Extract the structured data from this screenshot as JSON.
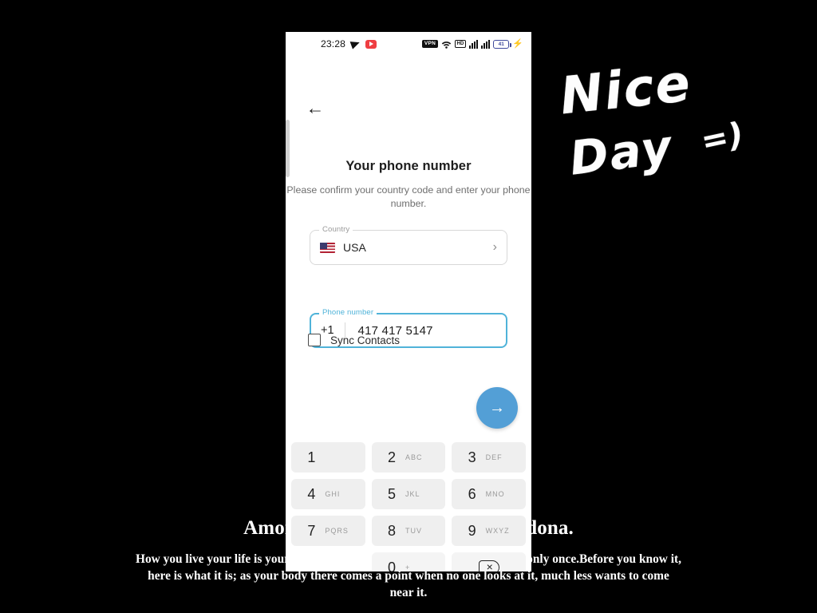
{
  "background": {
    "quote_title": "Amor ch'a nullo amato amar perdona.",
    "quote_body": "How you live your life is your own business, and our bodies are given to us only once.Before you know it,  here is what it is; as your body there comes a point when no one looks at it,  much less wants to come near it.",
    "handwritten_line1": "Nice",
    "handwritten_line2": "Day",
    "handwritten_smiley": "=)",
    "canvas_color": "#000000"
  },
  "phone": {
    "status_bar": {
      "clock": "23:28",
      "left_icons": [
        "telegram-icon",
        "youtube-icon"
      ],
      "vpn_label": "VPN",
      "hd_label": "HD",
      "battery_level": "41",
      "right_icons": [
        "vpn-badge",
        "wifi-icon",
        "hd-badge",
        "signal-bars-1",
        "signal-bars-2",
        "battery-icon",
        "charging-bolt-icon"
      ]
    },
    "screen": {
      "back_icon": "←",
      "title": "Your phone number",
      "subtitle": "Please confirm your country code and enter your phone number.",
      "country_field": {
        "label": "Country",
        "value": "USA",
        "flag": "us-flag-icon",
        "chevron": "›"
      },
      "phone_field": {
        "label": "Phone number",
        "prefix": "+1",
        "value": "417 417 5147",
        "focus_color": "#4fb3d9"
      },
      "sync": {
        "label": "Sync Contacts",
        "checked": false
      },
      "next_button": {
        "icon": "→",
        "color": "#539fd6"
      }
    },
    "keypad": [
      {
        "digit": "1",
        "letters": ""
      },
      {
        "digit": "2",
        "letters": "ABC"
      },
      {
        "digit": "3",
        "letters": "DEF"
      },
      {
        "digit": "4",
        "letters": "GHI"
      },
      {
        "digit": "5",
        "letters": "JKL"
      },
      {
        "digit": "6",
        "letters": "MNO"
      },
      {
        "digit": "7",
        "letters": "PQRS"
      },
      {
        "digit": "8",
        "letters": "TUV"
      },
      {
        "digit": "9",
        "letters": "WXYZ"
      },
      {
        "digit": "",
        "letters": ""
      },
      {
        "digit": "0",
        "letters": "+"
      },
      {
        "digit": "⌫",
        "letters": ""
      }
    ]
  }
}
